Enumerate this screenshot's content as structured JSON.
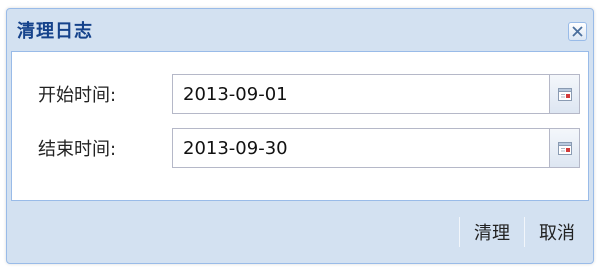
{
  "dialog": {
    "title": "清理日志",
    "close_icon": "close-icon"
  },
  "form": {
    "start": {
      "label": "开始时间:",
      "value": "2013-09-01",
      "icon": "calendar-icon"
    },
    "end": {
      "label": "结束时间:",
      "value": "2013-09-30",
      "icon": "calendar-icon"
    }
  },
  "footer": {
    "clean_label": "清理",
    "cancel_label": "取消"
  },
  "colors": {
    "title": "#15428b",
    "border": "#99bbe8",
    "frame_bg": "#d3e1f1"
  }
}
